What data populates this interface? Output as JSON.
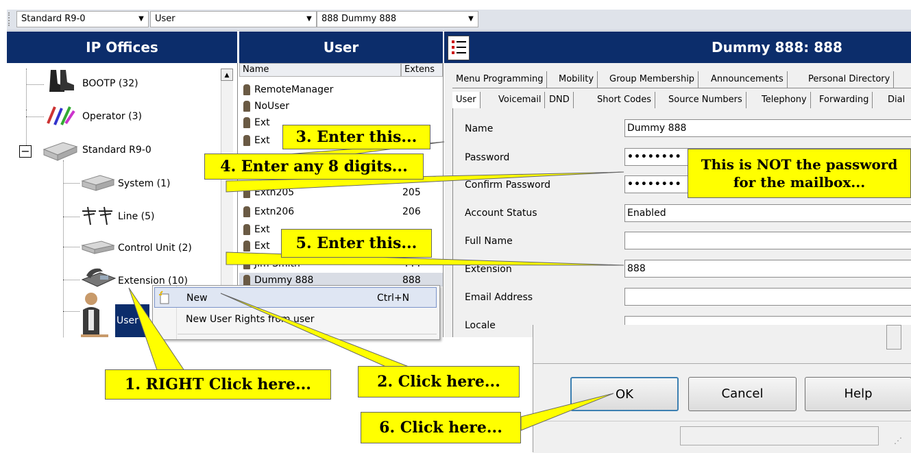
{
  "toolbar": {
    "combo1": "Standard R9-0",
    "combo2": "User",
    "combo3": "888 Dummy 888"
  },
  "panels": {
    "left_title": "IP Offices",
    "middle_title": "User",
    "right_title": "Dummy 888: 888"
  },
  "tree": {
    "items": [
      {
        "label": "BOOTP (32)",
        "icon": "boot-icon"
      },
      {
        "label": "Operator (3)",
        "icon": "operator-icon"
      },
      {
        "label": "Standard R9-0",
        "icon": "ip-office-unit-icon"
      },
      {
        "label": "System (1)",
        "icon": "system-unit-icon"
      },
      {
        "label": "Line (5)",
        "icon": "line-pole-icon"
      },
      {
        "label": "Control Unit (2)",
        "icon": "control-unit-icon"
      },
      {
        "label": "Extension (10)",
        "icon": "phone-icon"
      },
      {
        "label": "User",
        "icon": "user-icon"
      }
    ],
    "collapse_glyph": "−",
    "scroll_up": "▲"
  },
  "user_list": {
    "col_name": "Name",
    "col_ext": "Extens",
    "rows": [
      {
        "name": "RemoteManager",
        "ext": ""
      },
      {
        "name": "NoUser",
        "ext": ""
      },
      {
        "name": "Ext",
        "ext": ""
      },
      {
        "name": "Ext",
        "ext": ""
      },
      {
        "name": "",
        "ext": ""
      },
      {
        "name": "",
        "ext": ""
      },
      {
        "name": "Extn205",
        "ext": "205"
      },
      {
        "name": "Extn206",
        "ext": "206"
      },
      {
        "name": "Ext",
        "ext": ""
      },
      {
        "name": "Ext",
        "ext": ""
      },
      {
        "name": "Jim Smith",
        "ext": "444"
      },
      {
        "name": "Dummy 888",
        "ext": "888"
      }
    ]
  },
  "tabs_row1": [
    "Menu Programming",
    "Mobility",
    "Group Membership",
    "Announcements",
    "Personal Directory"
  ],
  "tabs_row2": [
    "User",
    "Voicemail",
    "DND",
    "Short Codes",
    "Source Numbers",
    "Telephony",
    "Forwarding",
    "Dial"
  ],
  "form": {
    "name_label": "Name",
    "name_value": "Dummy 888",
    "password_label": "Password",
    "password_value": "••••••••",
    "confirm_label": "Confirm Password",
    "confirm_value": "••••••••",
    "status_label": "Account Status",
    "status_value": "Enabled",
    "fullname_label": "Full Name",
    "fullname_value": "",
    "extension_label": "Extension",
    "extension_value": "888",
    "email_label": "Email Address",
    "email_value": "",
    "locale_label": "Locale",
    "locale_value": ""
  },
  "context_menu": {
    "new_label": "New",
    "new_shortcut": "Ctrl+N",
    "rights_label": "New User Rights from user"
  },
  "dialog": {
    "ok": "OK",
    "cancel": "Cancel",
    "help": "Help"
  },
  "callouts": {
    "c1": "1. RIGHT Click here...",
    "c2": "2. Click here...",
    "c3": "3. Enter this...",
    "c4": "4. Enter any 8 digits...",
    "c5": "5. Enter this...",
    "c6": "6. Click here...",
    "note_line1": "This is NOT the password",
    "note_line2": "for the mailbox..."
  },
  "colors": {
    "header_blue": "#0c2d6b",
    "callout_yellow": "#ffff00",
    "selection": "#0c2d6b"
  }
}
